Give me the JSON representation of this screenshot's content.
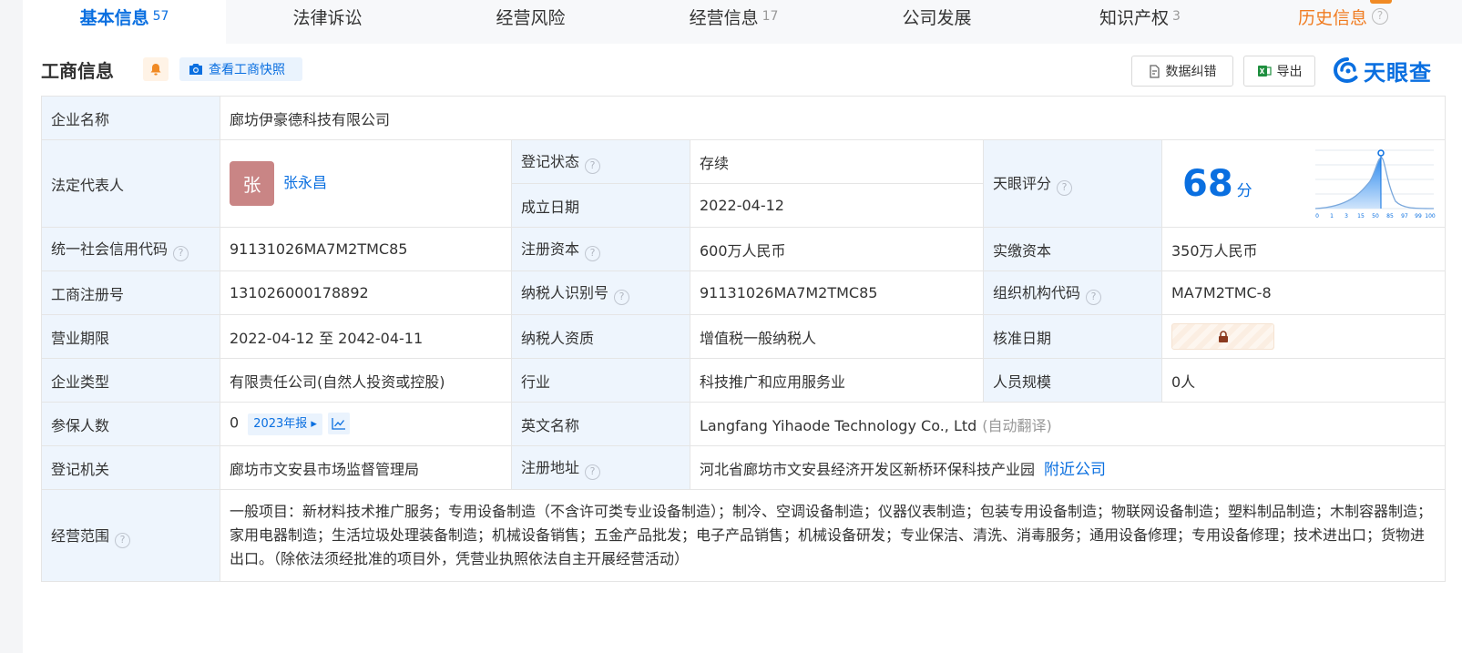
{
  "tabs": [
    {
      "label": "基本信息",
      "count": "57"
    },
    {
      "label": "法律诉讼",
      "count": ""
    },
    {
      "label": "经营风险",
      "count": ""
    },
    {
      "label": "经营信息",
      "count": "17"
    },
    {
      "label": "公司发展",
      "count": ""
    },
    {
      "label": "知识产权",
      "count": "3"
    },
    {
      "label": "历史信息",
      "count": ""
    }
  ],
  "header": {
    "title": "工商信息",
    "snapshot_label": "查看工商快照",
    "correct_label": "数据纠错",
    "export_label": "导出",
    "brand": "天眼查"
  },
  "info": {
    "company_name_label": "企业名称",
    "company_name": "廊坊伊豪德科技有限公司",
    "legal_rep_label": "法定代表人",
    "legal_rep_avatar": "张",
    "legal_rep": "张永昌",
    "reg_status_label": "登记状态",
    "reg_status": "存续",
    "found_date_label": "成立日期",
    "found_date": "2022-04-12",
    "score_label": "天眼评分",
    "score": "68",
    "score_unit": "分",
    "credit_code_label": "统一社会信用代码",
    "credit_code": "91131026MA7M2TMC85",
    "reg_capital_label": "注册资本",
    "reg_capital": "600万人民币",
    "paid_capital_label": "实缴资本",
    "paid_capital": "350万人民币",
    "reg_no_label": "工商注册号",
    "reg_no": "131026000178892",
    "taxpayer_id_label": "纳税人识别号",
    "taxpayer_id": "91131026MA7M2TMC85",
    "org_code_label": "组织机构代码",
    "org_code": "MA7M2TMC-8",
    "term_label": "营业期限",
    "term": "2022-04-12 至 2042-04-11",
    "taxpayer_qual_label": "纳税人资质",
    "taxpayer_qual": "增值税一般纳税人",
    "approve_date_label": "核准日期",
    "type_label": "企业类型",
    "type": "有限责任公司(自然人投资或控股)",
    "industry_label": "行业",
    "industry": "科技推广和应用服务业",
    "staff_label": "人员规模",
    "staff": "0人",
    "insured_label": "参保人数",
    "insured": "0",
    "insured_report": "2023年报",
    "english_name_label": "英文名称",
    "english_name": "Langfang Yihaode Technology Co., Ltd",
    "english_name_note": "(自动翻译)",
    "authority_label": "登记机关",
    "authority": "廊坊市文安县市场监督管理局",
    "address_label": "注册地址",
    "address": "河北省廊坊市文安县经济开发区新桥环保科技产业园",
    "nearby_label": "附近公司",
    "scope_label": "经营范围",
    "scope": "一般项目：新材料技术推广服务；专用设备制造（不含许可类专业设备制造）；制冷、空调设备制造；仪器仪表制造；包装专用设备制造；物联网设备制造；塑料制品制造；木制容器制造；家用电器制造；生活垃圾处理装备制造；机械设备销售；五金产品批发；电子产品销售；机械设备研发；专业保洁、清洗、消毒服务；通用设备修理；专用设备修理；技术进出口；货物进出口。（除依法须经批准的项目外，凭营业执照依法自主开展经营活动）"
  },
  "score_chart": {
    "ticks": [
      "0",
      "1",
      "3",
      "15",
      "50",
      "85",
      "97",
      "99",
      "100"
    ]
  },
  "colors": {
    "accent": "#0a6fe0",
    "label_bg": "#eef5fd",
    "status_green": "#00a854",
    "history_orange": "#f07c21"
  }
}
